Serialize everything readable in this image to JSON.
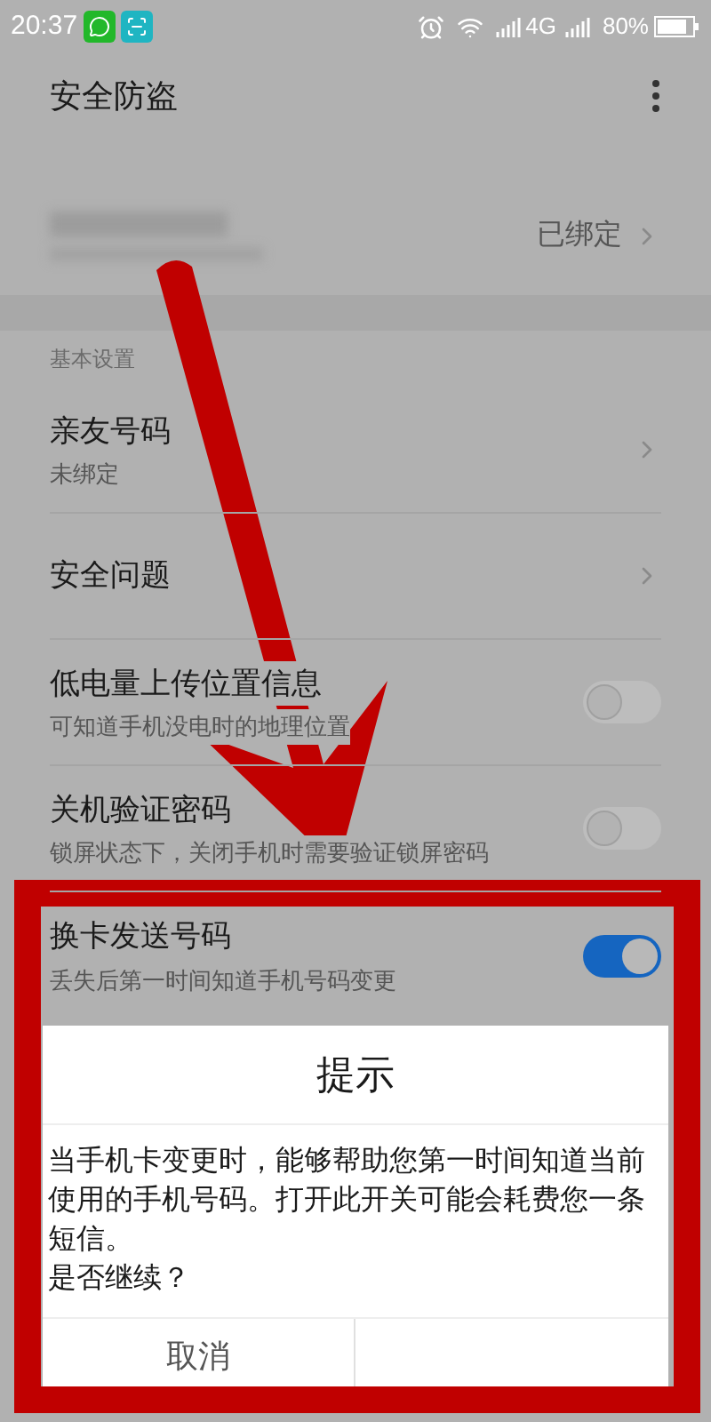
{
  "status_bar": {
    "time": "20:37",
    "network": "4G",
    "battery": "80%"
  },
  "app_bar": {
    "title": "安全防盗"
  },
  "owner_row": {
    "status": "已绑定"
  },
  "section": "基本设置",
  "settings": [
    {
      "kind": "link",
      "title": "亲友号码",
      "subtitle": "未绑定"
    },
    {
      "kind": "link",
      "title": "安全问题"
    },
    {
      "kind": "toggle",
      "title": "低电量上传位置信息",
      "subtitle": "可知道手机没电时的地理位置",
      "on": false
    },
    {
      "kind": "toggle",
      "title": "关机验证密码",
      "subtitle": "锁屏状态下，关闭手机时需要验证锁屏密码",
      "on": false
    },
    {
      "kind": "toggle",
      "title": "换卡发送号码",
      "subtitle": "丢失后第一时间知道手机号码变更",
      "on": true
    }
  ],
  "dialog": {
    "title": "提示",
    "message": "当手机卡变更时，能够帮助您第一时间知道当前使用的手机号码。打开此开关可能会耗费您一条短信。",
    "question": "是否继续？",
    "buttons": [
      "取消"
    ]
  }
}
